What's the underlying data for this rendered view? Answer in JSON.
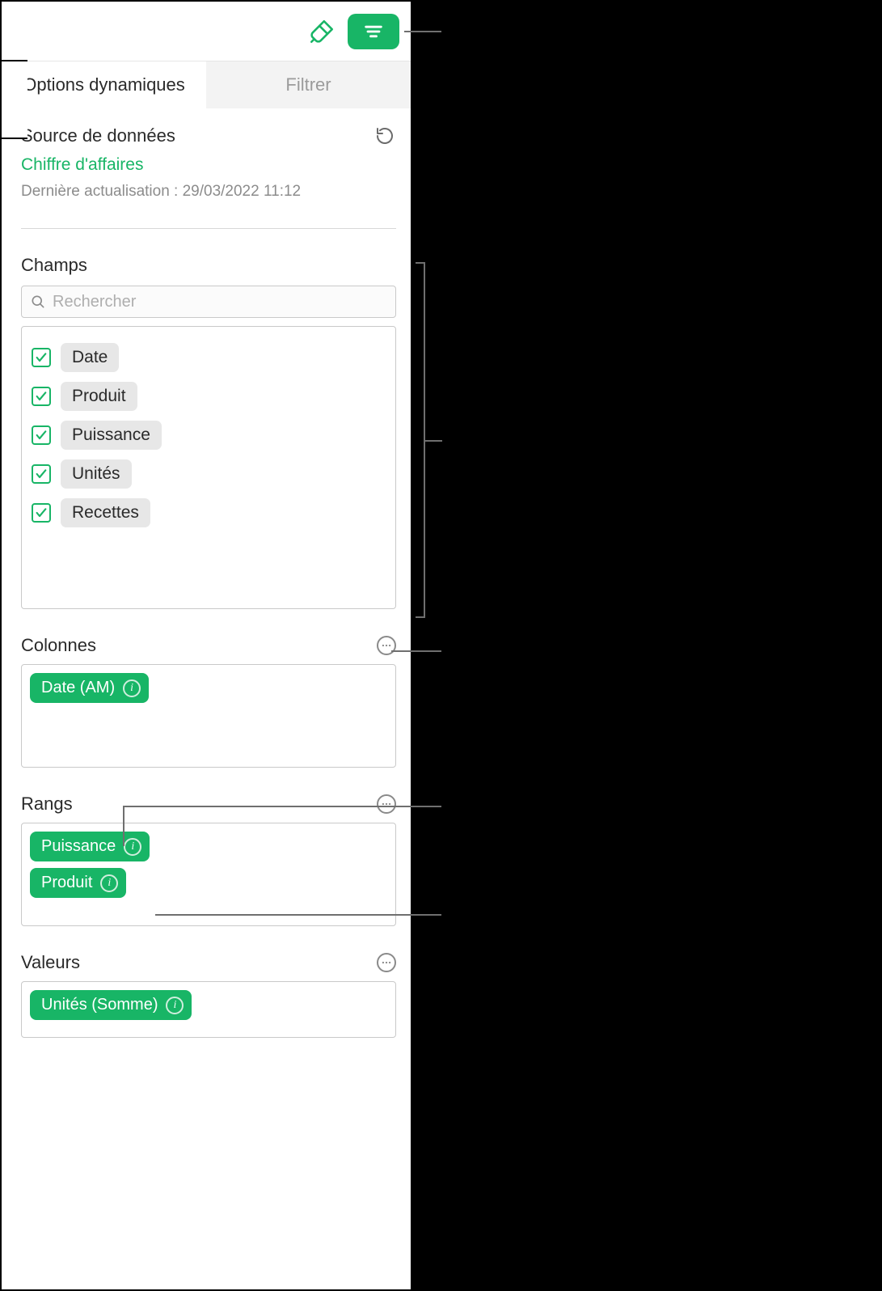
{
  "tabs": {
    "options": "Options dynamiques",
    "filter": "Filtrer"
  },
  "datasource": {
    "title": "Source de données",
    "link": "Chiffre d'affaires",
    "updated": "Dernière actualisation : 29/03/2022 11:12"
  },
  "fields": {
    "title": "Champs",
    "search_placeholder": "Rechercher",
    "items": [
      "Date",
      "Produit",
      "Puissance",
      "Unités",
      "Recettes"
    ]
  },
  "columns": {
    "title": "Colonnes",
    "chips": [
      "Date (AM)"
    ]
  },
  "rows": {
    "title": "Rangs",
    "chips": [
      "Puissance",
      "Produit"
    ]
  },
  "values": {
    "title": "Valeurs",
    "chips": [
      "Unités (Somme)"
    ]
  }
}
